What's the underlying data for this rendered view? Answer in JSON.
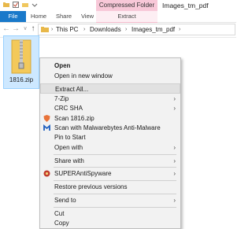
{
  "window": {
    "title": "Images_tm_pdf"
  },
  "ribbon": {
    "contextual_group": "Compressed Folder Tools",
    "tabs": [
      "File",
      "Home",
      "Share",
      "View",
      "Extract"
    ]
  },
  "address_bar": {
    "back": "←",
    "forward": "→",
    "recent": "∨",
    "up": "↑",
    "crumbs": [
      "This PC",
      "Downloads",
      "Images_tm_pdf"
    ],
    "separator": "›"
  },
  "file": {
    "name": "1816.zip"
  },
  "context_menu": {
    "items": [
      {
        "label": "Open",
        "bold": true
      },
      {
        "label": "Open in new window"
      },
      {
        "label": "Extract All..."
      },
      {
        "label": "7-Zip",
        "submenu": true
      },
      {
        "label": "CRC SHA",
        "submenu": true
      },
      {
        "label": "Scan 1816.zip",
        "icon": "defender-shield-icon"
      },
      {
        "label": "Scan with Malwarebytes Anti-Malware",
        "icon": "malwarebytes-icon"
      },
      {
        "label": "Pin to Start"
      },
      {
        "label": "Open with",
        "submenu": true
      },
      {
        "label": "Share with",
        "submenu": true
      },
      {
        "label": "SUPERAntiSpyware",
        "icon": "superantispyware-icon",
        "submenu": true
      },
      {
        "label": "Restore previous versions"
      },
      {
        "label": "Send to",
        "submenu": true
      },
      {
        "label": "Cut"
      },
      {
        "label": "Copy"
      }
    ],
    "arrow": "›"
  },
  "colors": {
    "file_tab": "#1979ca",
    "contextual": "#f8c8d8",
    "selection": "#cde8ff",
    "menu_bg": "#f2f2f2"
  }
}
